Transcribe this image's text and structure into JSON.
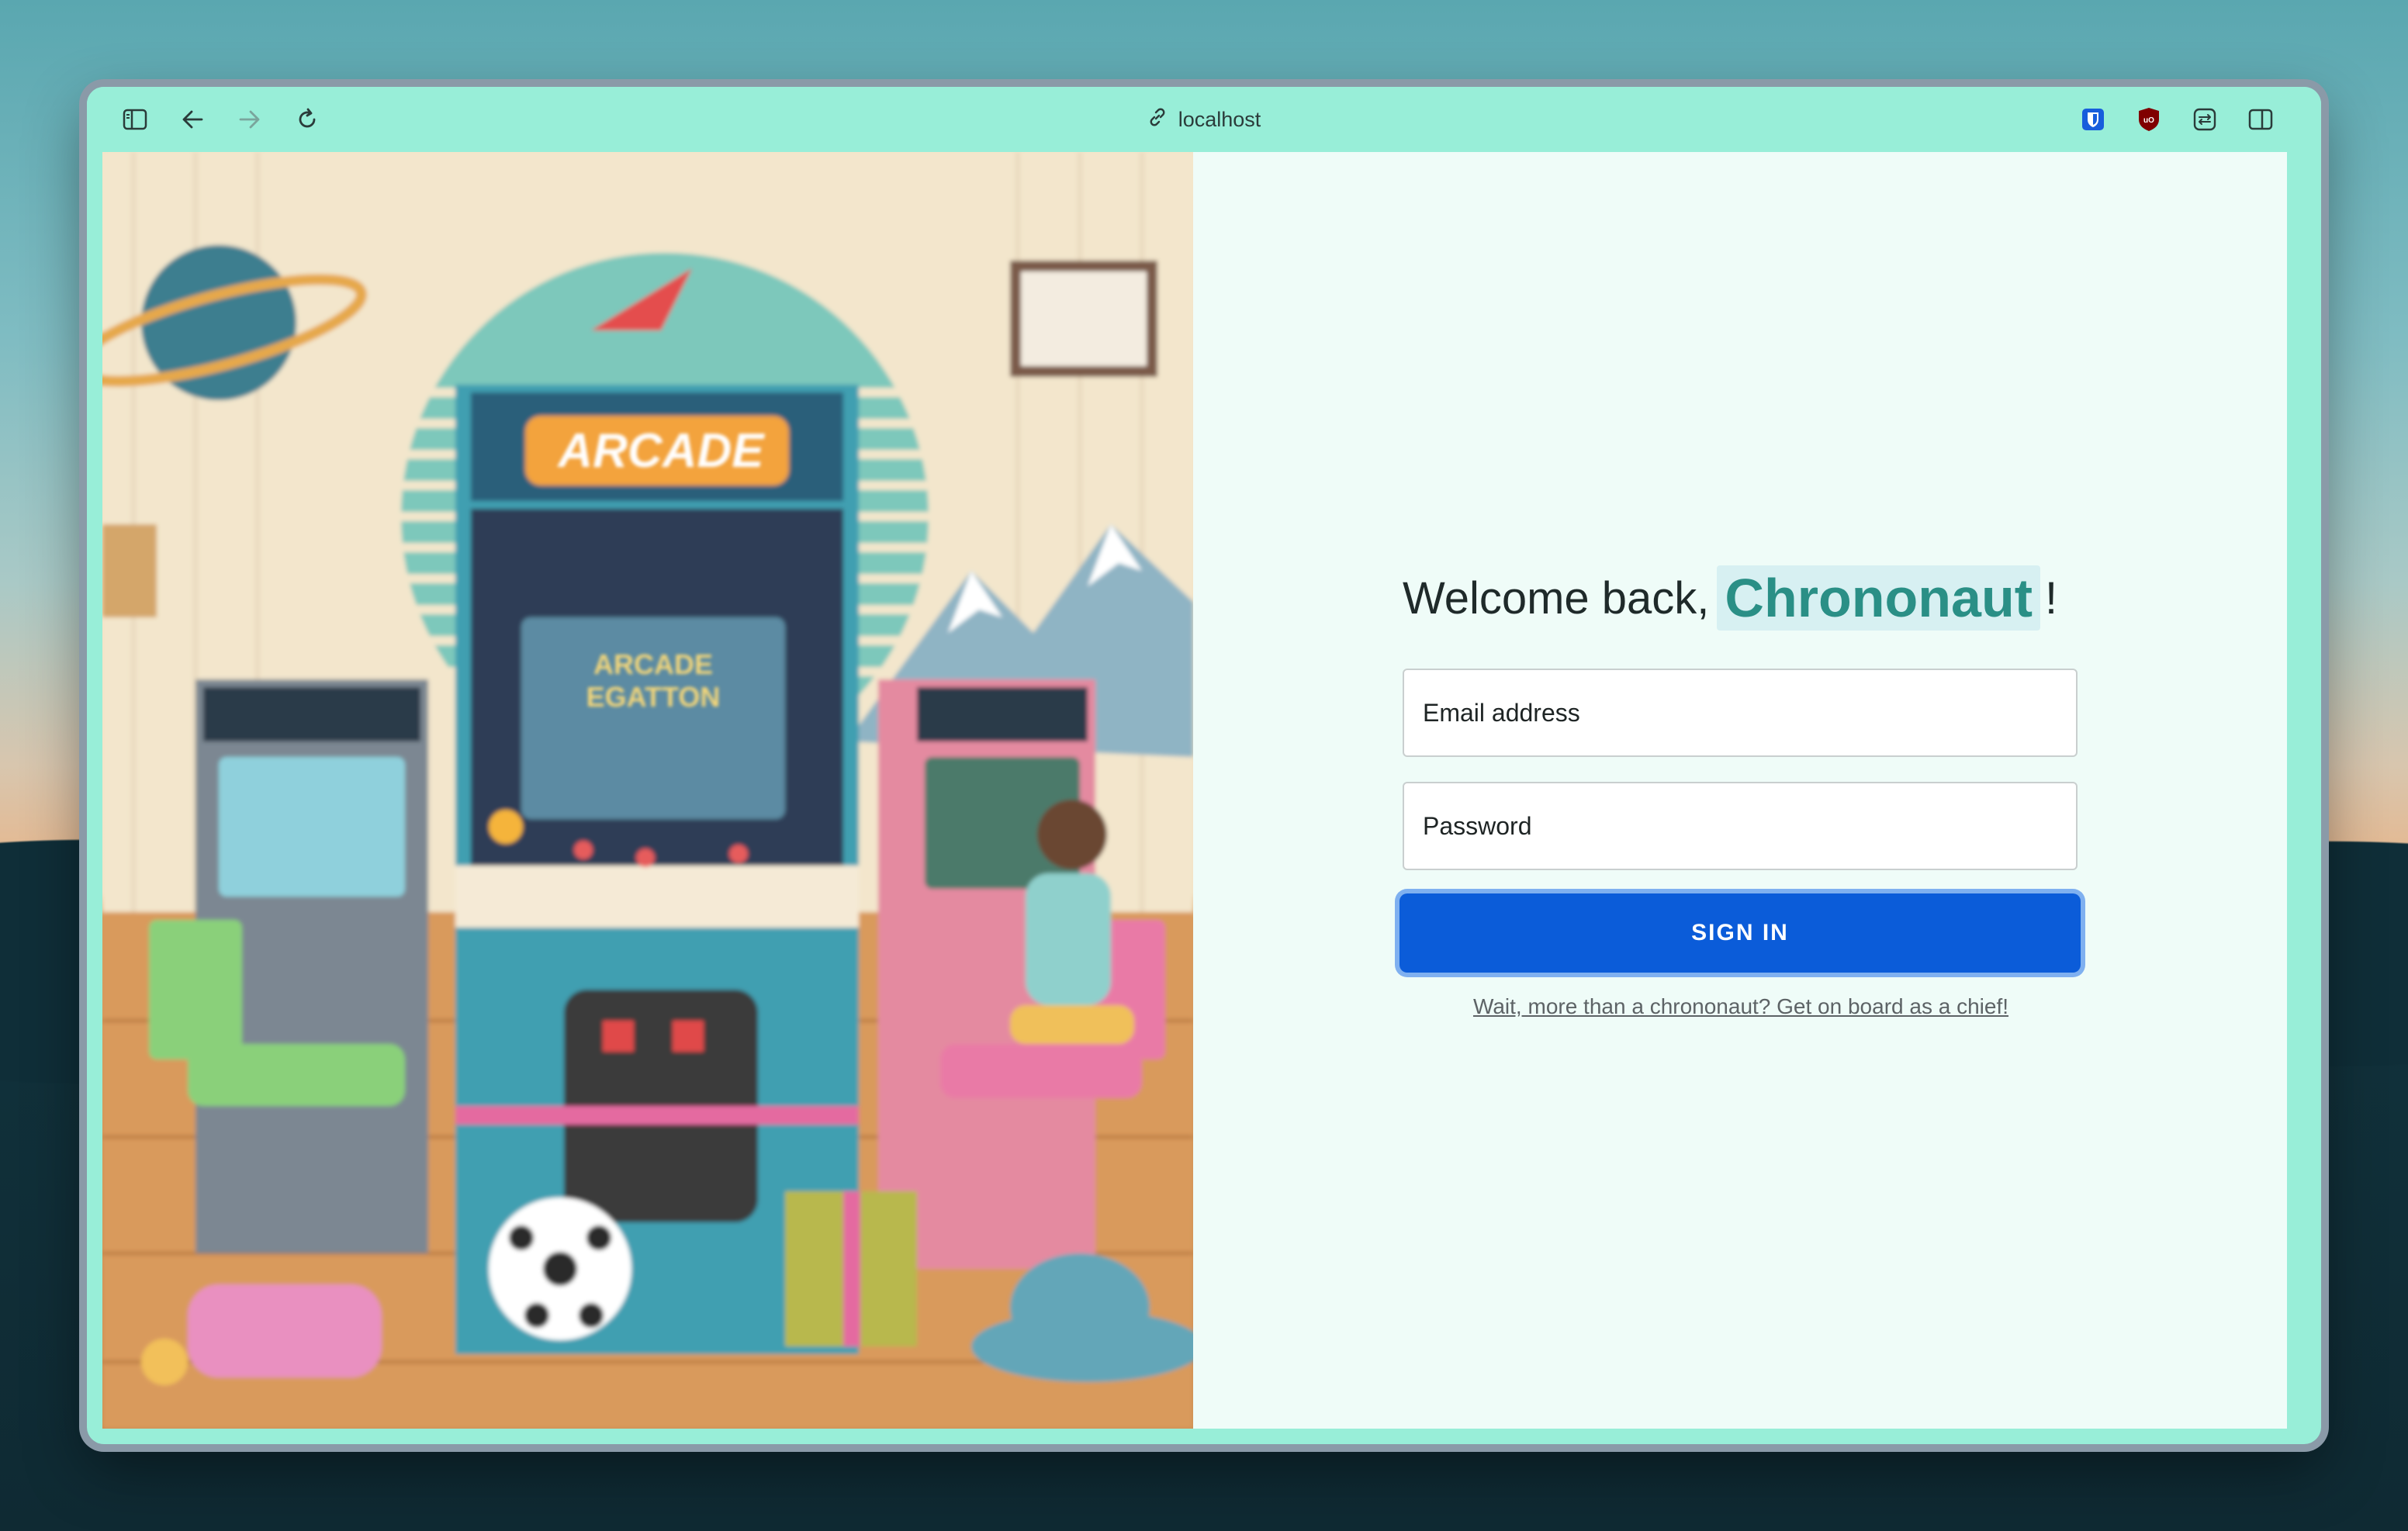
{
  "browser": {
    "url": "localhost",
    "icons": [
      "sidebar-toggle-icon",
      "back-arrow-icon",
      "forward-arrow-icon",
      "reload-icon",
      "link-icon",
      "bitwarden-icon",
      "ublock-icon",
      "extension-icon",
      "split-view-icon"
    ]
  },
  "login": {
    "welcome_prefix": "Welcome back,",
    "name": "Chrononaut",
    "welcome_suffix": "!",
    "email_placeholder": "Email address",
    "password_placeholder": "Password",
    "signin_label": "SIGN IN",
    "chief_link": "Wait, more than a chrononaut? Get on board as a chief!"
  },
  "hero": {
    "marquee": "ARCADE",
    "screen_line1": "ARCADE",
    "screen_line2": "EGATTON"
  },
  "colors": {
    "toolbar": "#98eed8",
    "panel": "#effcf8",
    "accent": "#2a8f86",
    "button": "#0b5cd9"
  }
}
